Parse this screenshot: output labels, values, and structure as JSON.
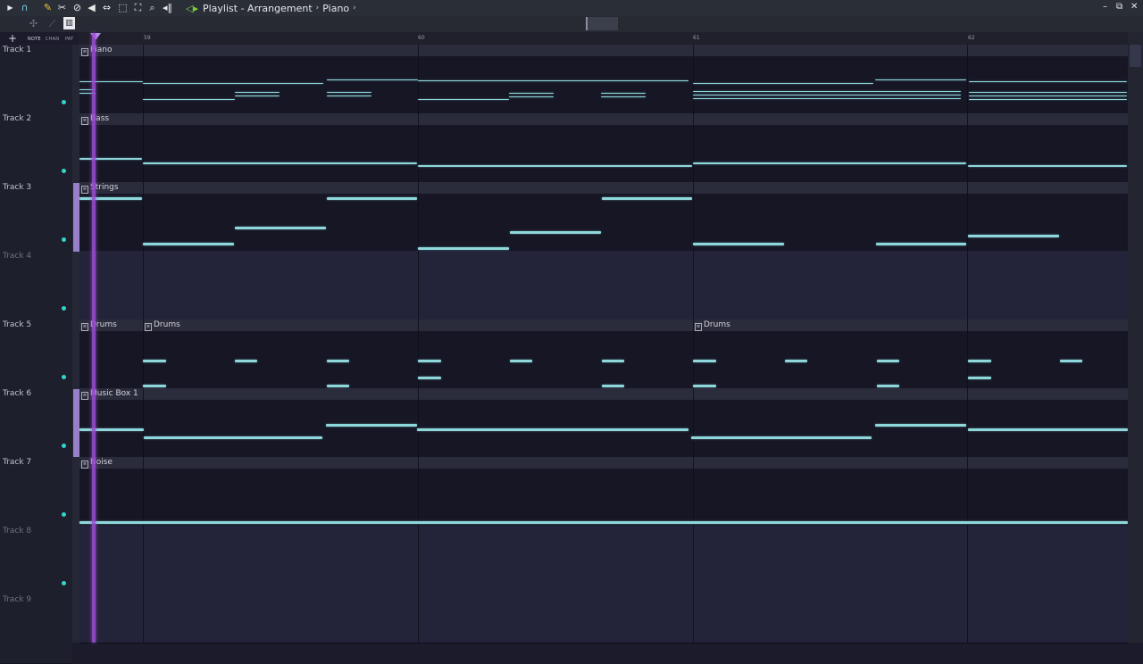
{
  "toolbar": {
    "icons": [
      "menu-arrow-icon",
      "magnet-icon",
      "pencil-icon",
      "paint-icon",
      "delete-icon",
      "mute-icon",
      "slip-icon",
      "select-icon",
      "zoom-icon",
      "playback-icon"
    ],
    "breadcrumb": [
      "Playlist - Arrangement",
      "Piano"
    ],
    "window_buttons": [
      "minimize",
      "maximize",
      "close"
    ]
  },
  "bar2": {
    "mini_labels": [
      "NOTE",
      "CHAN",
      "PAT"
    ]
  },
  "ruler": {
    "bars": [
      "59",
      "60",
      "61",
      "62"
    ]
  },
  "tracks": [
    {
      "label": "Track 1",
      "clip": "Piano"
    },
    {
      "label": "Track 2",
      "clip": "Bass"
    },
    {
      "label": "Track 3",
      "clip": "Strings"
    },
    {
      "label": "Track 4",
      "clip": ""
    },
    {
      "label": "Track 5",
      "clips": [
        "Drums",
        "Drums",
        "Drums"
      ]
    },
    {
      "label": "Track 6",
      "clip": "Music Box 1"
    },
    {
      "label": "Track 7",
      "clip": "Noise"
    },
    {
      "label": "Track 8",
      "clip": ""
    },
    {
      "label": "Track 9",
      "clip": ""
    }
  ],
  "colors": {
    "note": "#8ed8dc",
    "playhead": "#9b4fd3",
    "accent_dot": "#31d6c9"
  }
}
